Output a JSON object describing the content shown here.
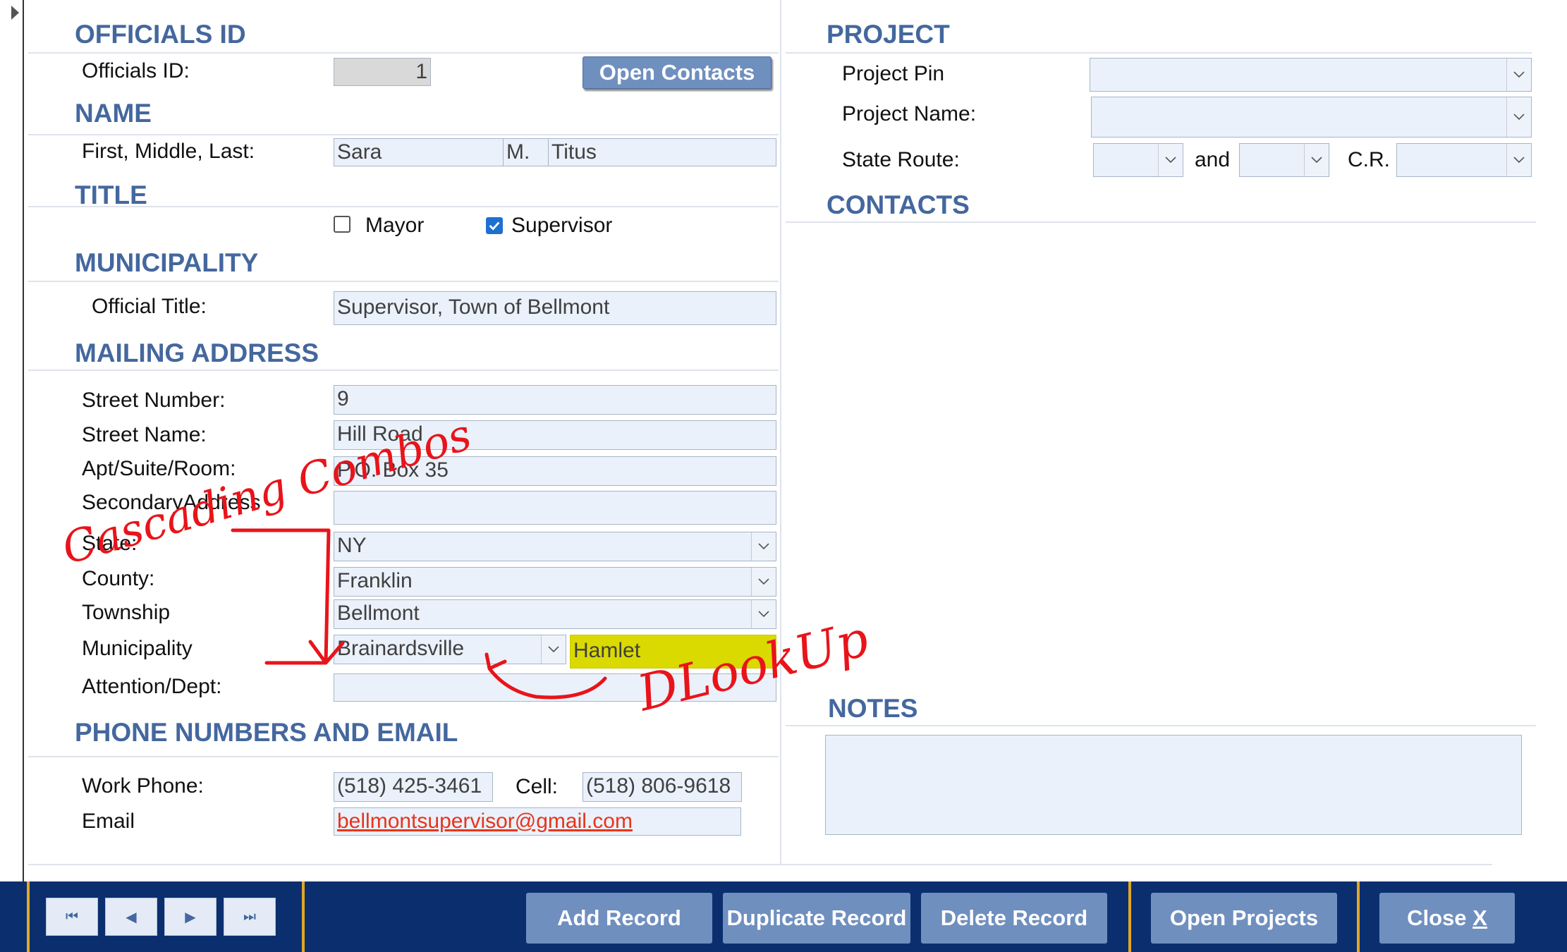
{
  "sections": {
    "officials_id": "OFFICIALS ID",
    "name": "NAME",
    "title": "TITLE",
    "municipality": "MUNICIPALITY",
    "mailing_address": "MAILING ADDRESS",
    "phone_email": "PHONE NUMBERS AND EMAIL",
    "project": "PROJECT",
    "contacts": "CONTACTS",
    "notes": "NOTES"
  },
  "official": {
    "id_label": "Officials ID:",
    "id_value": "1",
    "open_contacts": "Open Contacts",
    "name_label": "First, Middle, Last:",
    "first": "Sara",
    "middle": "M.",
    "last": "Titus",
    "mayor_label": "Mayor",
    "mayor_checked": false,
    "supervisor_label": "Supervisor",
    "supervisor_checked": true,
    "official_title_label": "Official Title:",
    "official_title": "Supervisor, Town of Bellmont"
  },
  "address": {
    "street_number_label": "Street Number:",
    "street_number": "9",
    "street_name_label": "Street Name:",
    "street_name": "Hill Road",
    "apt_label": "Apt/Suite/Room:",
    "apt": "P.O. Box 35",
    "secondary_label": "SecondaryAddress",
    "secondary": "",
    "state_label": "State:",
    "state": "NY",
    "county_label": "County:",
    "county": "Franklin",
    "township_label": "Township",
    "township": "Bellmont",
    "municipality_label": "Municipality",
    "municipality": "Brainardsville",
    "municipality_type": "Hamlet",
    "attention_label": "Attention/Dept:",
    "attention": ""
  },
  "phones": {
    "work_label": "Work Phone:",
    "work": "(518) 425-3461",
    "cell_label": "Cell:",
    "cell": "(518) 806-9618",
    "email_label": "Email",
    "email": "bellmontsupervisor@gmail.com"
  },
  "project": {
    "pin_label": "Project Pin",
    "pin": "",
    "name_label": "Project Name:",
    "name": "",
    "route_label": "State Route:",
    "route1": "",
    "and_label": "and",
    "route2": "",
    "cr_label": "C.R.",
    "cr": ""
  },
  "notes": {
    "value": ""
  },
  "toolbar": {
    "first": "⏮",
    "prev": "◀",
    "next": "▶",
    "last": "⏭",
    "add": "Add Record",
    "duplicate": "Duplicate Record",
    "delete": "Delete Record",
    "open_projects": "Open Projects",
    "close": "Close",
    "close_x": "X"
  },
  "annotations": {
    "cascading": "Cascading Combos",
    "dlookup": "DLookUp"
  },
  "colors": {
    "accent": "#44679e",
    "field_bg": "#eaf1fb",
    "toolbar_bg": "#0b2f6e",
    "highlight": "#dada00",
    "annotation": "#e8141a"
  }
}
